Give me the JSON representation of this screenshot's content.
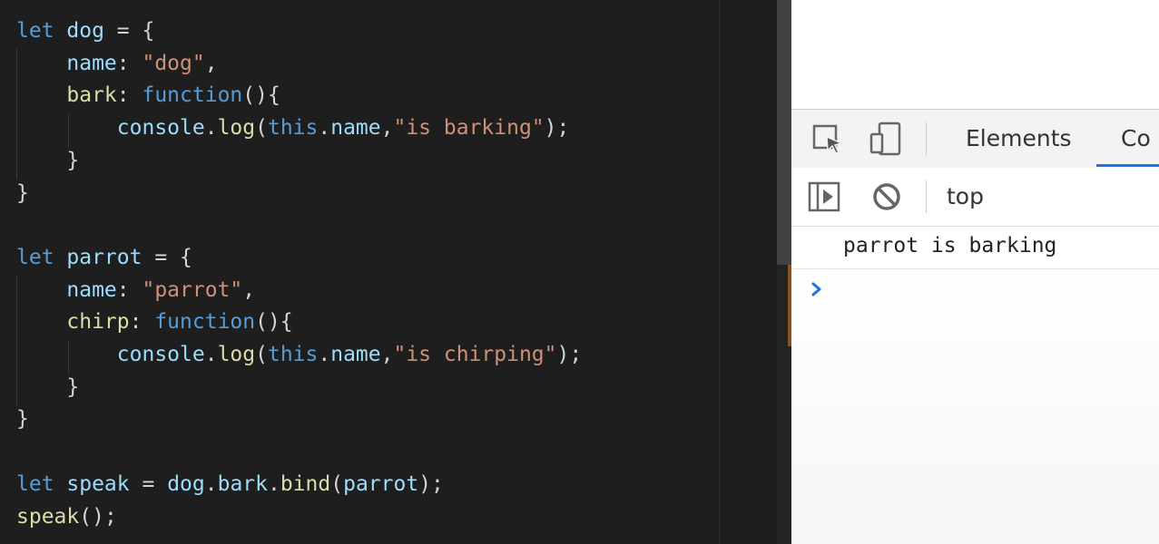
{
  "editor": {
    "colors": {
      "keyword": "#569cd6",
      "variable": "#9cdcfe",
      "property": "#d4d4d4",
      "string": "#ce9178",
      "function": "#dcdcaa",
      "punctuation": "#d4d4d4"
    },
    "lines": [
      [
        {
          "t": "let",
          "c": "keyword"
        },
        {
          "t": " dog",
          "c": "variable"
        },
        {
          "t": " = {",
          "c": "punctuation"
        }
      ],
      [
        {
          "t": "    name",
          "c": "variable"
        },
        {
          "t": ": ",
          "c": "punctuation"
        },
        {
          "t": "\"dog\"",
          "c": "string"
        },
        {
          "t": ",",
          "c": "punctuation"
        }
      ],
      [
        {
          "t": "    bark",
          "c": "function"
        },
        {
          "t": ": ",
          "c": "punctuation"
        },
        {
          "t": "function",
          "c": "keyword"
        },
        {
          "t": "(){",
          "c": "punctuation"
        }
      ],
      [
        {
          "t": "        console",
          "c": "variable"
        },
        {
          "t": ".",
          "c": "punctuation"
        },
        {
          "t": "log",
          "c": "function"
        },
        {
          "t": "(",
          "c": "punctuation"
        },
        {
          "t": "this",
          "c": "keyword"
        },
        {
          "t": ".",
          "c": "punctuation"
        },
        {
          "t": "name",
          "c": "variable"
        },
        {
          "t": ",",
          "c": "punctuation"
        },
        {
          "t": "\"is barking\"",
          "c": "string"
        },
        {
          "t": ");",
          "c": "punctuation"
        }
      ],
      [
        {
          "t": "    }",
          "c": "punctuation"
        }
      ],
      [
        {
          "t": "}",
          "c": "punctuation"
        }
      ],
      [],
      [
        {
          "t": "let",
          "c": "keyword"
        },
        {
          "t": " parrot",
          "c": "variable"
        },
        {
          "t": " = {",
          "c": "punctuation"
        }
      ],
      [
        {
          "t": "    name",
          "c": "variable"
        },
        {
          "t": ": ",
          "c": "punctuation"
        },
        {
          "t": "\"parrot\"",
          "c": "string"
        },
        {
          "t": ",",
          "c": "punctuation"
        }
      ],
      [
        {
          "t": "    chirp",
          "c": "function"
        },
        {
          "t": ": ",
          "c": "punctuation"
        },
        {
          "t": "function",
          "c": "keyword"
        },
        {
          "t": "(){",
          "c": "punctuation"
        }
      ],
      [
        {
          "t": "        console",
          "c": "variable"
        },
        {
          "t": ".",
          "c": "punctuation"
        },
        {
          "t": "log",
          "c": "function"
        },
        {
          "t": "(",
          "c": "punctuation"
        },
        {
          "t": "this",
          "c": "keyword"
        },
        {
          "t": ".",
          "c": "punctuation"
        },
        {
          "t": "name",
          "c": "variable"
        },
        {
          "t": ",",
          "c": "punctuation"
        },
        {
          "t": "\"is chirping\"",
          "c": "string"
        },
        {
          "t": ");",
          "c": "punctuation"
        }
      ],
      [
        {
          "t": "    }",
          "c": "punctuation"
        }
      ],
      [
        {
          "t": "}",
          "c": "punctuation"
        }
      ],
      [],
      [
        {
          "t": "let",
          "c": "keyword"
        },
        {
          "t": " speak",
          "c": "variable"
        },
        {
          "t": " = ",
          "c": "punctuation"
        },
        {
          "t": "dog",
          "c": "variable"
        },
        {
          "t": ".",
          "c": "punctuation"
        },
        {
          "t": "bark",
          "c": "variable"
        },
        {
          "t": ".",
          "c": "punctuation"
        },
        {
          "t": "bind",
          "c": "function"
        },
        {
          "t": "(",
          "c": "punctuation"
        },
        {
          "t": "parrot",
          "c": "variable"
        },
        {
          "t": ");",
          "c": "punctuation"
        }
      ],
      [
        {
          "t": "speak",
          "c": "function"
        },
        {
          "t": "();",
          "c": "punctuation"
        }
      ]
    ]
  },
  "devtools": {
    "toolbar": {
      "inspect_icon": "inspect-element-icon",
      "device_icon": "device-toolbar-icon",
      "tabs": [
        {
          "label": "Elements",
          "active": false
        },
        {
          "label": "Co",
          "active": true
        }
      ],
      "accent": "#1a73e8"
    },
    "console_bar": {
      "sidebar_icon": "show-sidebar-icon",
      "clear_icon": "clear-console-icon",
      "context": "top"
    },
    "console": {
      "messages": [
        "parrot is barking"
      ],
      "prompt_icon": "prompt-chevron-icon",
      "prompt_color": "#1a73e8"
    }
  }
}
